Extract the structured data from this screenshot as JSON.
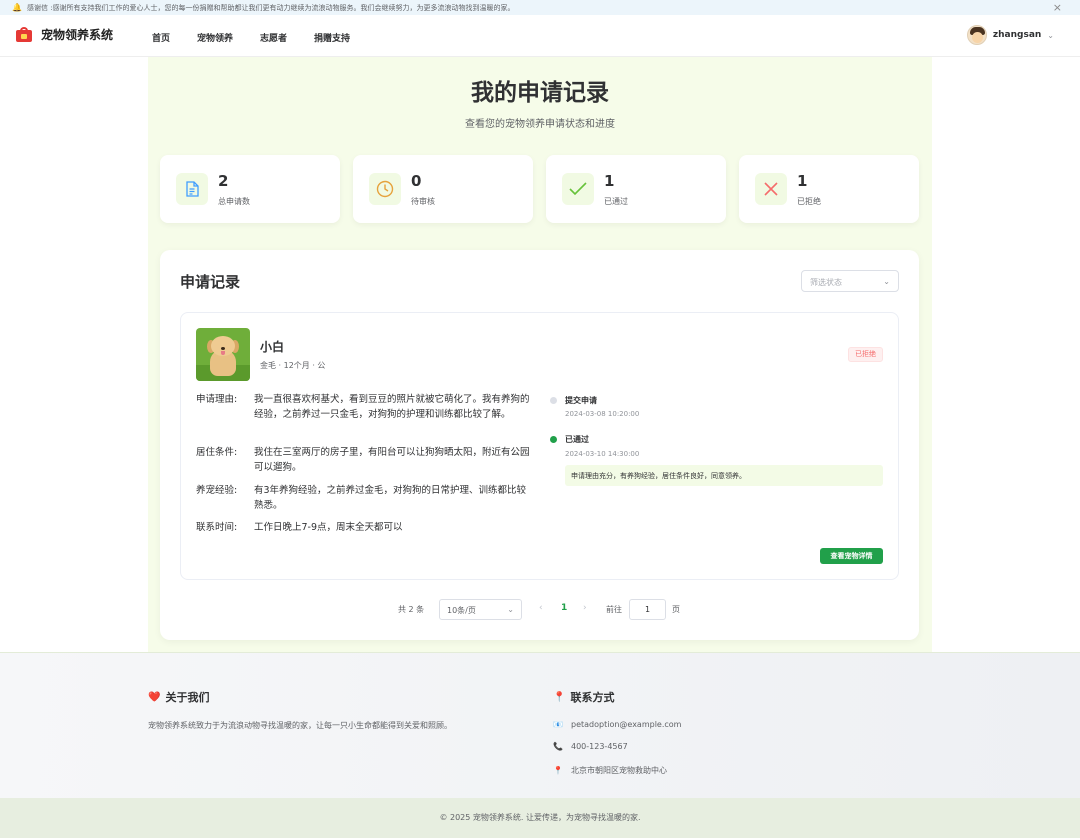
{
  "notice": {
    "text": "感谢信 :感谢所有支持我们工作的爱心人士，您的每一份捐赠和帮助都让我们更有动力继续为流浪动物服务。我们会继续努力，为更多流浪动物找到温暖的家。",
    "close": "×"
  },
  "nav": {
    "brand": "宠物领养系统",
    "links": [
      "首页",
      "宠物领养",
      "志愿者",
      "捐赠支持"
    ],
    "username": "zhangsan"
  },
  "header": {
    "title": "我的申请记录",
    "subtitle": "查看您的宠物领养申请状态和进度"
  },
  "stats": [
    {
      "value": "2",
      "label": "总申请数",
      "icon": "document-icon",
      "color": "#409eff"
    },
    {
      "value": "0",
      "label": "待审核",
      "icon": "clock-icon",
      "color": "#e6a23c"
    },
    {
      "value": "1",
      "label": "已通过",
      "icon": "check-icon",
      "color": "#67c23a"
    },
    {
      "value": "1",
      "label": "已拒绝",
      "icon": "close-icon",
      "color": "#f56c6c"
    }
  ],
  "records": {
    "title": "申请记录",
    "filter_placeholder": "筛选状态",
    "application": {
      "pet_name": "小白",
      "pet_meta": "金毛 · 12个月 · 公",
      "status": "已拒绝",
      "fields": [
        {
          "label": "申请理由:",
          "value": "我一直很喜欢柯基犬，看到豆豆的照片就被它萌化了。我有养狗的经验，之前养过一只金毛，对狗狗的护理和训练都比较了解。"
        },
        {
          "label": "居住条件:",
          "value": "我住在三室两厅的房子里，有阳台可以让狗狗晒太阳，附近有公园可以遛狗。"
        },
        {
          "label": "养宠经验:",
          "value": "有3年养狗经验，之前养过金毛，对狗狗的日常护理、训练都比较熟悉。"
        },
        {
          "label": "联系时间:",
          "value": "工作日晚上7-9点，周末全天都可以"
        }
      ],
      "timeline": [
        {
          "title": "提交申请",
          "time": "2024-03-08 10:20:00"
        },
        {
          "title": "已通过",
          "time": "2024-03-10 14:30:00",
          "note": "申请理由充分，有养狗经验，居住条件良好，同意领养。"
        }
      ],
      "detail_button": "查看宠物详情"
    },
    "pagination": {
      "total": "共 2 条",
      "page_size": "10条/页",
      "current_page": "1",
      "goto_label": "前往",
      "goto_value": "1",
      "page_suffix": "页"
    }
  },
  "footer": {
    "about_title": "关于我们",
    "about_text": "宠物领养系统致力于为流浪动物寻找温暖的家，让每一只小生命都能得到关爱和照顾。",
    "contact_title": "联系方式",
    "email": "petadoption@example.com",
    "phone": "400-123-4567",
    "address": "北京市朝阳区宠物救助中心",
    "copyright": "© 2025 宠物领养系统. 让爱传递，为宠物寻找温暖的家."
  },
  "colors": {
    "accent_green": "#21a04a",
    "page_bg": "#f6fce9",
    "reject_red": "#f56c6c"
  }
}
